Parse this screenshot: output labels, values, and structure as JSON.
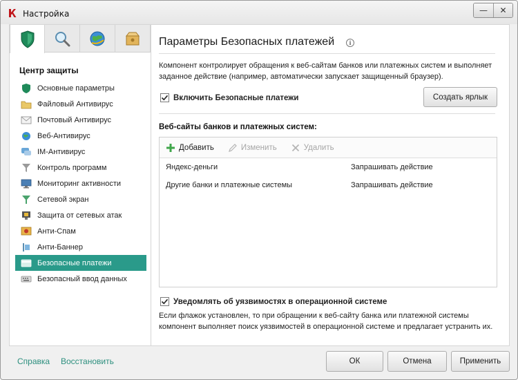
{
  "window": {
    "title": "Настройка",
    "minimize_glyph": "—",
    "close_glyph": "✕"
  },
  "left": {
    "tabs": [
      {
        "icon": "shield-icon",
        "active": true
      },
      {
        "icon": "magnifier-icon",
        "active": false
      },
      {
        "icon": "globe-icon",
        "active": false
      },
      {
        "icon": "box-icon",
        "active": false
      }
    ],
    "section_title": "Центр защиты",
    "items": [
      {
        "label": "Основные параметры",
        "icon": "shield-small-icon"
      },
      {
        "label": "Файловый Антивирус",
        "icon": "folder-icon"
      },
      {
        "label": "Почтовый Антивирус",
        "icon": "mail-icon"
      },
      {
        "label": "Веб-Антивирус",
        "icon": "globe-small-icon"
      },
      {
        "label": "IM-Антивирус",
        "icon": "chat-icon"
      },
      {
        "label": "Контроль программ",
        "icon": "funnel-icon"
      },
      {
        "label": "Мониторинг активности",
        "icon": "monitor-icon"
      },
      {
        "label": "Сетевой экран",
        "icon": "network-filter-icon"
      },
      {
        "label": "Защита от сетевых атак",
        "icon": "network-attack-icon"
      },
      {
        "label": "Анти-Спам",
        "icon": "antispam-icon"
      },
      {
        "label": "Анти-Баннер",
        "icon": "antibanner-icon"
      },
      {
        "label": "Безопасные платежи",
        "icon": "card-icon",
        "selected": true
      },
      {
        "label": "Безопасный ввод данных",
        "icon": "keyboard-icon"
      }
    ]
  },
  "main": {
    "title": "Параметры Безопасных платежей",
    "info_glyph": "i",
    "description": "Компонент контролирует обращения к веб-сайтам банков или платежных систем и выполняет заданное действие (например, автоматически запускает защищенный браузер).",
    "enable_checkbox_label": "Включить Безопасные платежи",
    "enable_checked": true,
    "create_shortcut_label": "Создать ярлык",
    "sites_heading": "Веб-сайты банков и платежных систем:",
    "toolbar": {
      "add": "Добавить",
      "edit": "Изменить",
      "delete": "Удалить"
    },
    "rows": [
      {
        "site": "Яндекс-деньги",
        "action": "Запрашивать действие"
      },
      {
        "site": "Другие банки и платежные системы",
        "action": "Запрашивать действие"
      }
    ],
    "notify_checkbox_label": "Уведомлять об уязвимостях в операционной системе",
    "notify_checked": true,
    "notify_description": "Если флажок установлен, то при обращении к веб-сайту банка или платежной системы компонент выполняет поиск уязвимостей в операционной системе и предлагает устранить их."
  },
  "footer": {
    "help_link": "Справка",
    "restore_link": "Восстановить",
    "ok": "ОК",
    "cancel": "Отмена",
    "apply": "Применить"
  },
  "colors": {
    "accent": "#2a9a8a",
    "link": "#2c8f7e"
  }
}
